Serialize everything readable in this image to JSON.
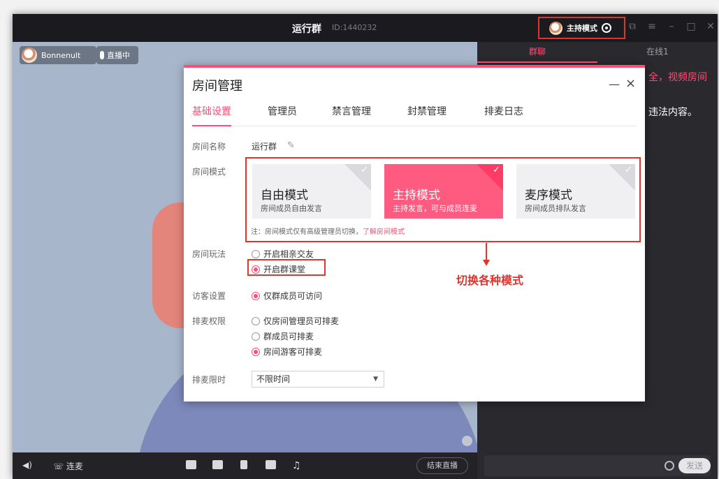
{
  "titlebar": {
    "title": "运行群",
    "room_id": "ID:1440232",
    "mode_badge": "主持模式",
    "icons": [
      "gear-icon",
      "popout-icon",
      "menu-icon",
      "minimize-icon",
      "maximize-icon",
      "close-icon"
    ]
  },
  "stage": {
    "host_name": "Bonnenult",
    "live_status": "直播中"
  },
  "bottombar": {
    "connect_label": "连麦",
    "end_live_label": "结束直播"
  },
  "right_panel": {
    "tabs": [
      "群聊",
      "在线1"
    ],
    "active_tab": 0,
    "notice_line1": "全，视频房间",
    "notice_line2": "违法内容。",
    "send_label": "发送"
  },
  "dialog": {
    "title": "房间管理",
    "tabs": [
      "基础设置",
      "管理员",
      "禁言管理",
      "封禁管理",
      "排麦日志"
    ],
    "active_tab": 0,
    "labels": {
      "room_name": "房间名称",
      "room_mode": "房间模式",
      "room_play": "房间玩法",
      "visitor": "访客设置",
      "queue_perm": "排麦权限",
      "queue_limit": "排麦限时"
    },
    "room_name_value": "运行群",
    "modes": [
      {
        "name": "自由模式",
        "desc": "房间成员自由发言",
        "selected": false
      },
      {
        "name": "主持模式",
        "desc": "主持发言，可与成员连麦",
        "selected": true
      },
      {
        "name": "麦序模式",
        "desc": "房间成员排队发言",
        "selected": false
      }
    ],
    "mode_note": "注：房间模式仅有高级管理员切换，",
    "mode_note_link": "了解房间模式",
    "play_options": [
      {
        "label": "开启相亲交友",
        "selected": false
      },
      {
        "label": "开启群课堂",
        "selected": true
      }
    ],
    "visitor_option": "仅群成员可访问",
    "queue_options": [
      {
        "label": "仅房间管理员可排麦",
        "selected": false
      },
      {
        "label": "群成员可排麦",
        "selected": false
      },
      {
        "label": "房间游客可排麦",
        "selected": true
      }
    ],
    "queue_limit_value": "不限时间"
  },
  "annotation": {
    "text": "切换各种模式"
  },
  "colors": {
    "accent": "#ff4e75",
    "annotation_red": "#e0342f",
    "window_bg": "#1f1f23"
  }
}
